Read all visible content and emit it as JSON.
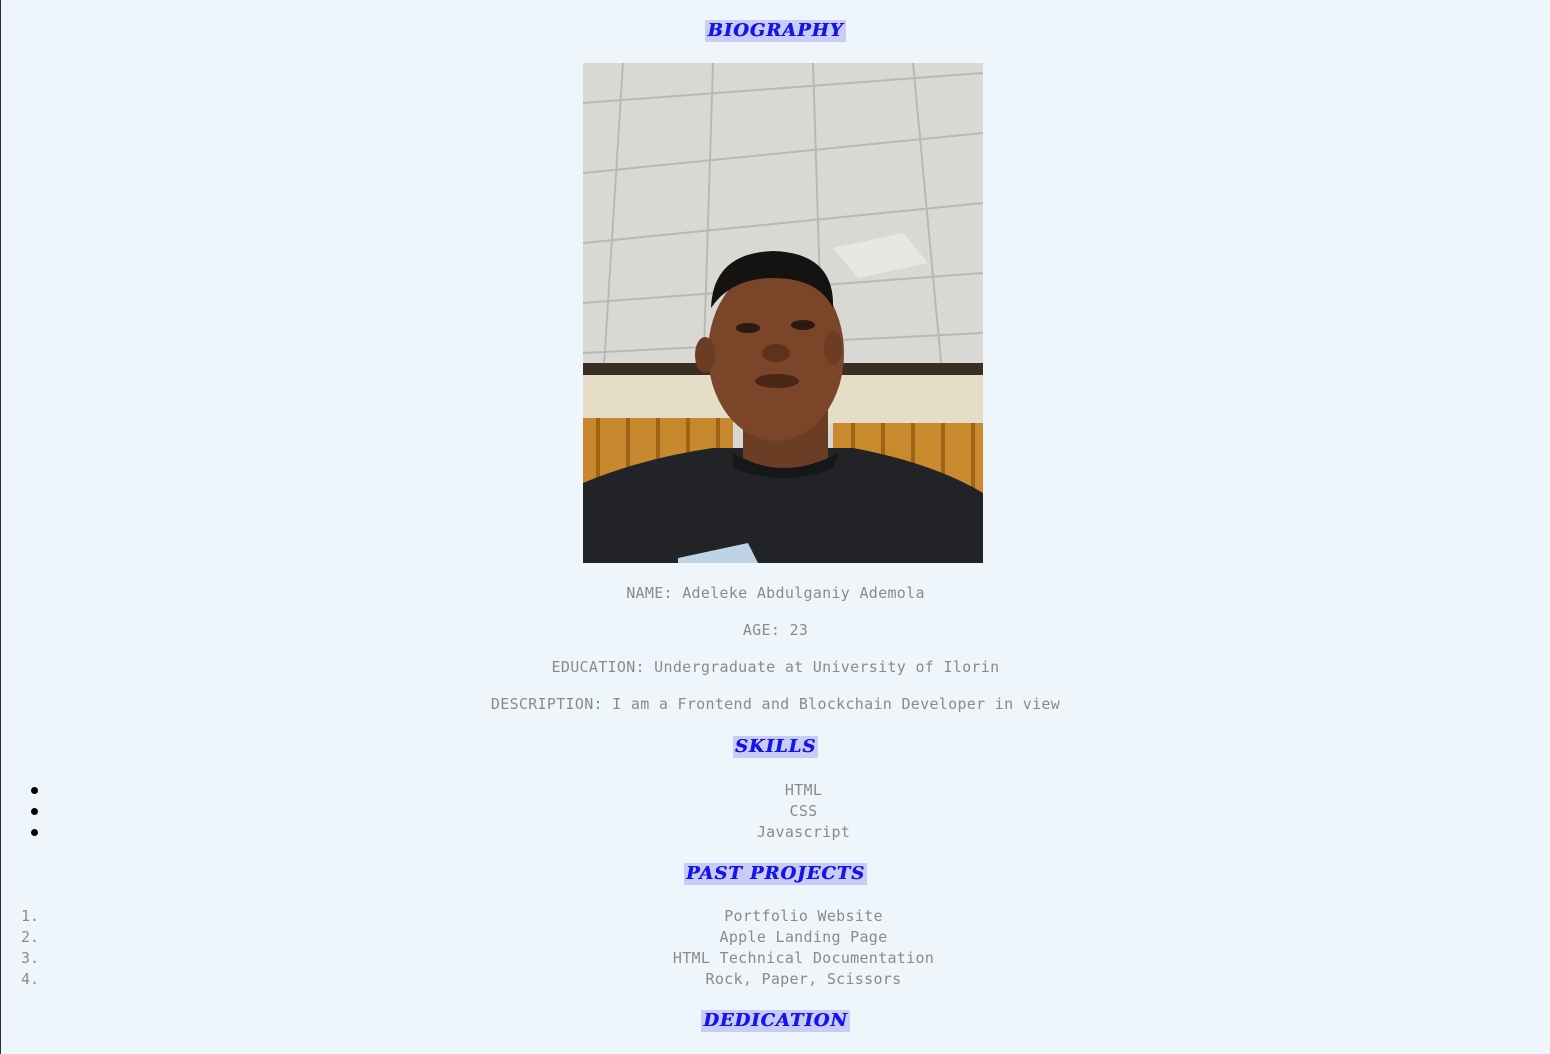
{
  "biography_heading": "BIOGRAPHY",
  "photo_alt": "portrait-photo",
  "info": {
    "name": "NAME: Adeleke Abdulganiy Ademola",
    "age": "AGE: 23",
    "education": "EDUCATION: Undergraduate at University of Ilorin",
    "description": "DESCRIPTION: I am a Frontend and Blockchain Developer in view"
  },
  "skills_heading": "SKILLS",
  "skills": [
    "HTML",
    "CSS",
    "Javascript"
  ],
  "projects_heading": "PAST PROJECTS",
  "projects": [
    {
      "num": "1.",
      "label": "Portfolio Website"
    },
    {
      "num": "2.",
      "label": "Apple Landing Page"
    },
    {
      "num": "3.",
      "label": "HTML Technical Documentation"
    },
    {
      "num": "4.",
      "label": "Rock, Paper, Scissors"
    }
  ],
  "dedication_heading": "DEDICATION"
}
